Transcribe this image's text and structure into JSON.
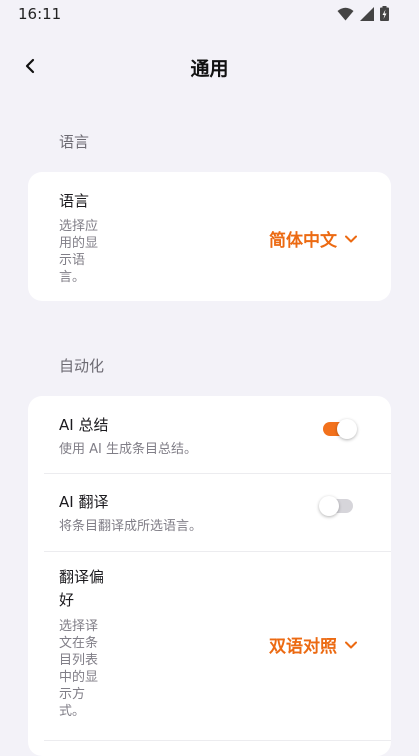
{
  "status_bar": {
    "time": "16:11"
  },
  "header": {
    "title": "通用"
  },
  "sections": {
    "language": {
      "label": "语言",
      "row": {
        "title": "语言",
        "subtitle_lines": [
          "选择应",
          "用的显",
          "示语",
          "言。"
        ],
        "value": "简体中文"
      }
    },
    "automation": {
      "label": "自动化",
      "ai_summary": {
        "title": "AI 总结",
        "subtitle": "使用 AI 生成条目总结。",
        "enabled": true
      },
      "ai_translate": {
        "title": "AI 翻译",
        "subtitle": "将条目翻译成所选语言。",
        "enabled": false
      },
      "translation_pref": {
        "title_lines": [
          "翻译偏",
          "好"
        ],
        "subtitle_lines": [
          "选择译",
          "文在条",
          "目列表",
          "中的显",
          "示方",
          "式。"
        ],
        "value": "双语对照"
      }
    }
  },
  "colors": {
    "accent": "#ec6a12",
    "background": "#f3f2f8",
    "card": "#ffffff"
  }
}
